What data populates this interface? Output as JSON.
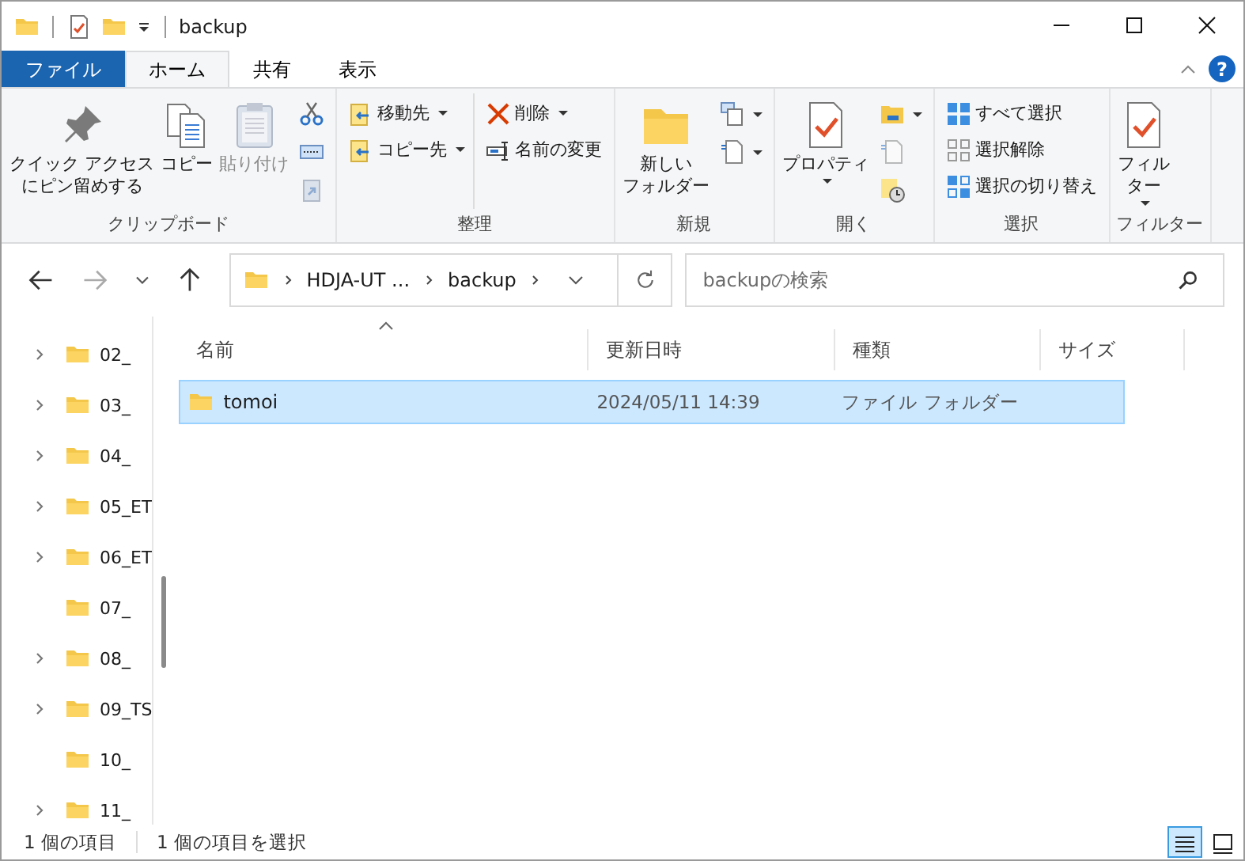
{
  "window": {
    "title": "backup"
  },
  "ribbon_tabs": [
    {
      "label": "ファイル",
      "kind": "file",
      "selected": false
    },
    {
      "label": "ホーム",
      "kind": "tab",
      "selected": true
    },
    {
      "label": "共有",
      "kind": "tab",
      "selected": false
    },
    {
      "label": "表示",
      "kind": "tab",
      "selected": false
    }
  ],
  "help": "?",
  "ribbon_groups": [
    {
      "label": "クリップボード",
      "columns": [
        [
          {
            "kind": "large",
            "lines": [
              "クイック アクセス",
              "にピン留めする"
            ],
            "dropdown": false,
            "disabled": false
          }
        ],
        [
          {
            "kind": "large",
            "lines": [
              "コピー"
            ],
            "dropdown": false,
            "disabled": false
          }
        ],
        [
          {
            "kind": "large",
            "lines": [
              "貼り付け"
            ],
            "dropdown": false,
            "disabled": true
          }
        ],
        [
          {
            "kind": "icon",
            "dropdown": false,
            "disabled": false
          },
          {
            "kind": "icon",
            "dropdown": false,
            "disabled": false
          },
          {
            "kind": "icon",
            "dropdown": false,
            "disabled": true
          }
        ]
      ]
    },
    {
      "label": "整理",
      "columns": [
        [
          {
            "kind": "small",
            "label": "移動先",
            "dropdown": true,
            "disabled": false
          },
          {
            "kind": "small",
            "label": "コピー先",
            "dropdown": true,
            "disabled": false
          }
        ],
        [
          {
            "kind": "small",
            "label": "削除",
            "dropdown": true,
            "disabled": false
          },
          {
            "kind": "small",
            "label": "名前の変更",
            "dropdown": false,
            "disabled": false
          }
        ]
      ]
    },
    {
      "label": "新規",
      "columns": [
        [
          {
            "kind": "large",
            "lines": [
              "新しい",
              "フォルダー"
            ],
            "dropdown": false,
            "disabled": false
          }
        ],
        [
          {
            "kind": "icon",
            "dropdown": true,
            "disabled": false
          },
          {
            "kind": "icon",
            "dropdown": true,
            "disabled": false
          }
        ]
      ]
    },
    {
      "label": "開く",
      "columns": [
        [
          {
            "kind": "large",
            "lines": [
              "プロパティ"
            ],
            "dropdown": true,
            "disabled": false
          }
        ],
        [
          {
            "kind": "icon",
            "dropdown": true,
            "disabled": false
          },
          {
            "kind": "icon",
            "dropdown": false,
            "disabled": true
          },
          {
            "kind": "icon",
            "dropdown": false,
            "disabled": false
          }
        ]
      ]
    },
    {
      "label": "選択",
      "columns": [
        [
          {
            "kind": "small",
            "label": "すべて選択",
            "dropdown": false,
            "disabled": false
          },
          {
            "kind": "small",
            "label": "選択解除",
            "dropdown": false,
            "disabled": false
          },
          {
            "kind": "small",
            "label": "選択の切り替え",
            "dropdown": false,
            "disabled": false
          }
        ]
      ]
    },
    {
      "label": "フィルター",
      "columns": [
        [
          {
            "kind": "large",
            "lines": [
              "フィル",
              "ター"
            ],
            "dropdown": true,
            "disabled": false
          }
        ]
      ]
    }
  ],
  "navigation": {
    "forward_disabled": true
  },
  "breadcrumbs": [
    "HDJA-UT ...",
    "backup"
  ],
  "search": {
    "placeholder": "backupの検索"
  },
  "nav_tree": [
    {
      "label": "02_",
      "has_children": true
    },
    {
      "label": "03_",
      "has_children": true
    },
    {
      "label": "04_",
      "has_children": true
    },
    {
      "label": "05_ET",
      "has_children": true
    },
    {
      "label": "06_ET",
      "has_children": true
    },
    {
      "label": "07_",
      "has_children": false
    },
    {
      "label": "08_",
      "has_children": true
    },
    {
      "label": "09_TS",
      "has_children": true
    },
    {
      "label": "10_",
      "has_children": false
    },
    {
      "label": "11_",
      "has_children": true
    }
  ],
  "table": {
    "columns": [
      "名前",
      "更新日時",
      "種類",
      "サイズ"
    ],
    "rows": [
      {
        "name": "tomoi",
        "modified": "2024/05/11 14:39",
        "type": "ファイル フォルダー",
        "selected": true
      }
    ]
  },
  "status_bar": {
    "items": [
      "1 個の項目",
      "1 個の項目を選択"
    ],
    "views": [
      {
        "kind": "details",
        "selected": true
      },
      {
        "kind": "large_icons",
        "selected": false
      }
    ]
  }
}
